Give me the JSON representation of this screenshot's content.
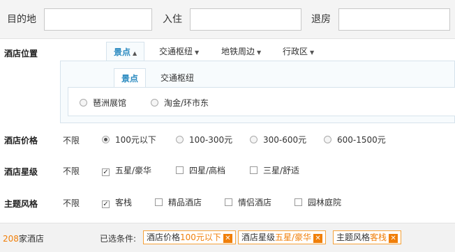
{
  "search": {
    "destination_label": "目的地",
    "destination_value": "",
    "checkin_label": "入住",
    "checkin_value": "",
    "checkout_label": "退房",
    "checkout_value": ""
  },
  "location": {
    "label": "酒店位置",
    "tabs": [
      {
        "label": "景点",
        "active": true
      },
      {
        "label": "交通枢纽",
        "active": false
      },
      {
        "label": "地铁周边",
        "active": false
      },
      {
        "label": "行政区",
        "active": false
      }
    ],
    "sub_tabs": [
      {
        "label": "景点",
        "active": true
      },
      {
        "label": "交通枢纽",
        "active": false
      }
    ],
    "options": [
      "琶洲展馆",
      "淘金/环市东"
    ]
  },
  "price": {
    "label": "酒店价格",
    "unlimited": "不限",
    "options": [
      {
        "label": "100元以下",
        "checked": true
      },
      {
        "label": "100-300元",
        "checked": false
      },
      {
        "label": "300-600元",
        "checked": false
      },
      {
        "label": "600-1500元",
        "checked": false
      }
    ]
  },
  "star": {
    "label": "酒店星级",
    "unlimited": "不限",
    "options": [
      {
        "label": "五星/豪华",
        "checked": true
      },
      {
        "label": "四星/高档",
        "checked": false
      },
      {
        "label": "三星/舒适",
        "checked": false
      }
    ]
  },
  "theme": {
    "label": "主题风格",
    "unlimited": "不限",
    "options": [
      {
        "label": "客栈",
        "checked": true
      },
      {
        "label": "精品酒店",
        "checked": false
      },
      {
        "label": "情侣酒店",
        "checked": false
      },
      {
        "label": "园林庭院",
        "checked": false
      }
    ]
  },
  "summary": {
    "count": "208",
    "count_suffix": "家酒店",
    "selected_label": "已选条件:",
    "tags": [
      {
        "prefix": "酒店价格",
        "value": "100元以下"
      },
      {
        "prefix": "酒店星级",
        "value": "五星/豪华"
      },
      {
        "prefix": "主题风格",
        "value": "客栈"
      }
    ],
    "remove_glyph": "✕"
  },
  "colors": {
    "accent_blue": "#2a8ac0",
    "accent_orange": "#f07f0a",
    "tag_border": "#f5a23a"
  }
}
